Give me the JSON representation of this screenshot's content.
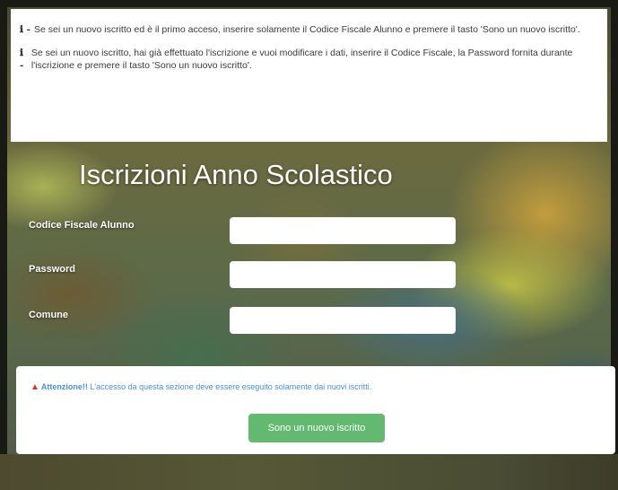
{
  "info": {
    "line1": "Se sei un nuovo iscritto ed è il primo acceso, inserire solamente il Codice Fiscale Alunno e premere il tasto 'Sono un nuovo iscritto'.",
    "line2": "Se sei un nuovo iscritto, hai già effettuato l'iscrizione e vuoi modificare i dati, inserire il Codice Fiscale, la Password fornita durante l'iscrizione e premere il tasto 'Sono un nuovo iscritto'.",
    "icon_glyph": "ℹ -"
  },
  "form": {
    "title": "Iscrizioni Anno Scolastico",
    "fields": [
      {
        "label": "Codice Fiscale Alunno",
        "value": ""
      },
      {
        "label": "Password",
        "value": ""
      },
      {
        "label": "Comune",
        "value": ""
      }
    ]
  },
  "warning": {
    "icon": "warning-triangle-icon",
    "icon_glyph": "▲",
    "strong": "Attenzione!!",
    "text": " L'accesso da questa sezione deve essere eseguito solamente dai nuovi iscritti.",
    "button_label": "Sono un nuovo iscritto"
  },
  "colors": {
    "button": "#62b96f",
    "warning_text": "#4a8fd4",
    "warning_icon": "#d9342b"
  }
}
